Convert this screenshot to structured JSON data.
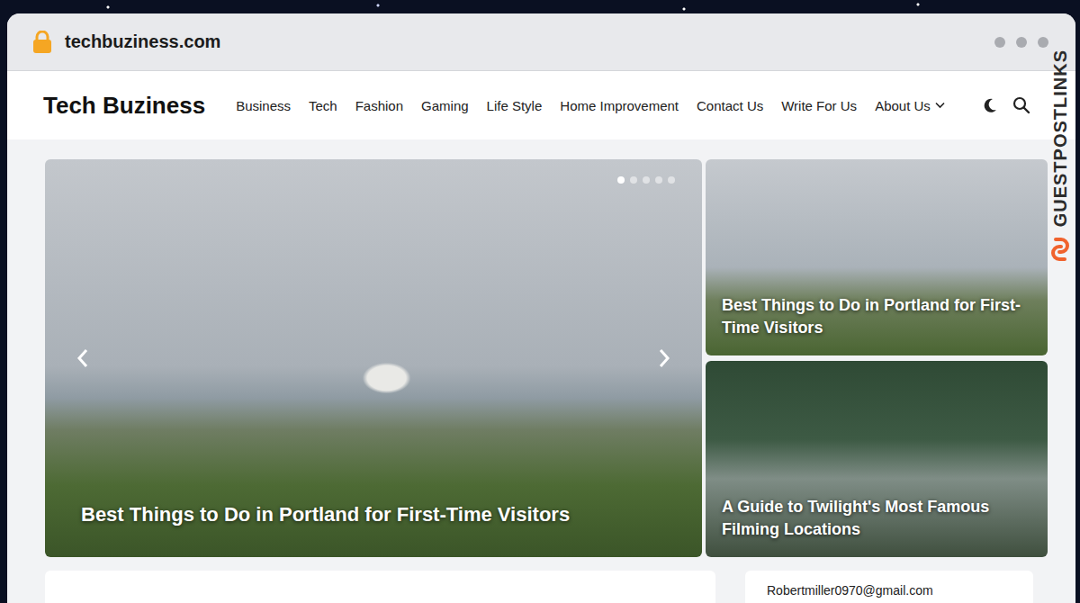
{
  "browser": {
    "url": "techbuziness.com"
  },
  "watermark": {
    "label": "GUESTPOSTLINKS"
  },
  "site": {
    "logo": "Tech Buziness",
    "nav": [
      {
        "label": "Business",
        "dropdown": false
      },
      {
        "label": "Tech",
        "dropdown": false
      },
      {
        "label": "Fashion",
        "dropdown": false
      },
      {
        "label": "Gaming",
        "dropdown": false
      },
      {
        "label": "Life Style",
        "dropdown": false
      },
      {
        "label": "Home Improvement",
        "dropdown": false
      },
      {
        "label": "Contact Us",
        "dropdown": false
      },
      {
        "label": "Write For Us",
        "dropdown": false
      },
      {
        "label": "About Us",
        "dropdown": true
      }
    ]
  },
  "slider": {
    "title": "Best Things to Do in Portland for First-Time Visitors",
    "dots": [
      {
        "selected": true
      },
      {
        "selected": false
      },
      {
        "selected": false
      },
      {
        "selected": false
      },
      {
        "selected": false
      }
    ]
  },
  "featured": [
    {
      "title": "Best Things to Do in Portland for First-Time Visitors",
      "kind": "coast"
    },
    {
      "title": "A Guide to Twilight's Most Famous Filming Locations",
      "kind": "forest"
    }
  ],
  "sidebar": {
    "email": "Robertmiller0970@gmail.com"
  }
}
